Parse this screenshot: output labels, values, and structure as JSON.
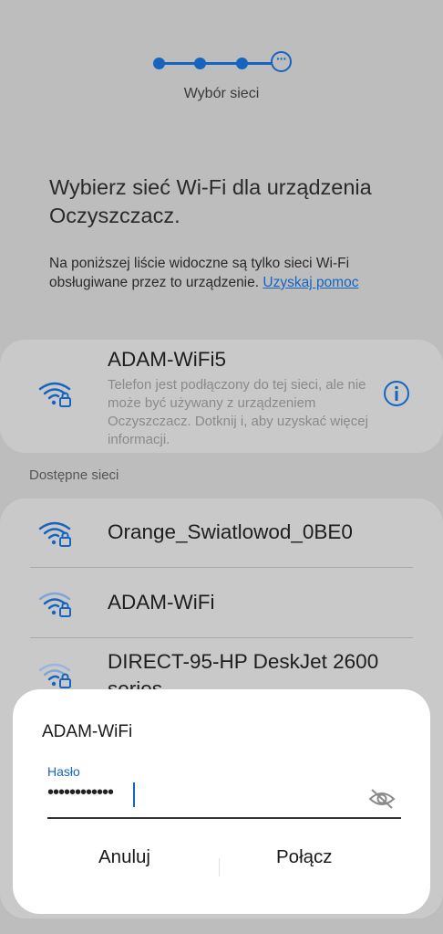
{
  "stepper": {
    "title": "Wybór sieci",
    "current_step_glyph": "···",
    "total_steps": 4,
    "current_step": 4
  },
  "heading": "Wybierz sieć Wi-Fi dla urządzenia Oczyszczacz.",
  "note": {
    "text": "Na poniższej liście widoczne są tylko sieci Wi-Fi obsługiwane przez to urządzenie. ",
    "link": "Uzyskaj pomoc"
  },
  "connected_network": {
    "ssid": "ADAM-WiFi5",
    "description": "Telefon jest podłączony do tej sieci, ale nie może być używany z urządzeniem Oczyszczacz. Dotknij i, aby uzyskać więcej informacji.",
    "icon": "wifi-lock-icon"
  },
  "available": {
    "label": "Dostępne sieci",
    "networks": [
      {
        "ssid": "Orange_Swiatlowod_0BE0",
        "signal": "full"
      },
      {
        "ssid": "ADAM-WiFi",
        "signal": "medium"
      },
      {
        "ssid": "DIRECT-95-HP DeskJet 2600 series",
        "signal": "low"
      }
    ]
  },
  "dialog": {
    "title": "ADAM-WiFi",
    "field_label": "Hasło",
    "password_mask": "••••••••••••",
    "cancel": "Anuluj",
    "connect": "Połącz"
  },
  "colors": {
    "accent": "#1565c0",
    "scrim_bg": "#bdbdbd",
    "card": "#c9c9c9",
    "dialog": "#ffffff"
  }
}
